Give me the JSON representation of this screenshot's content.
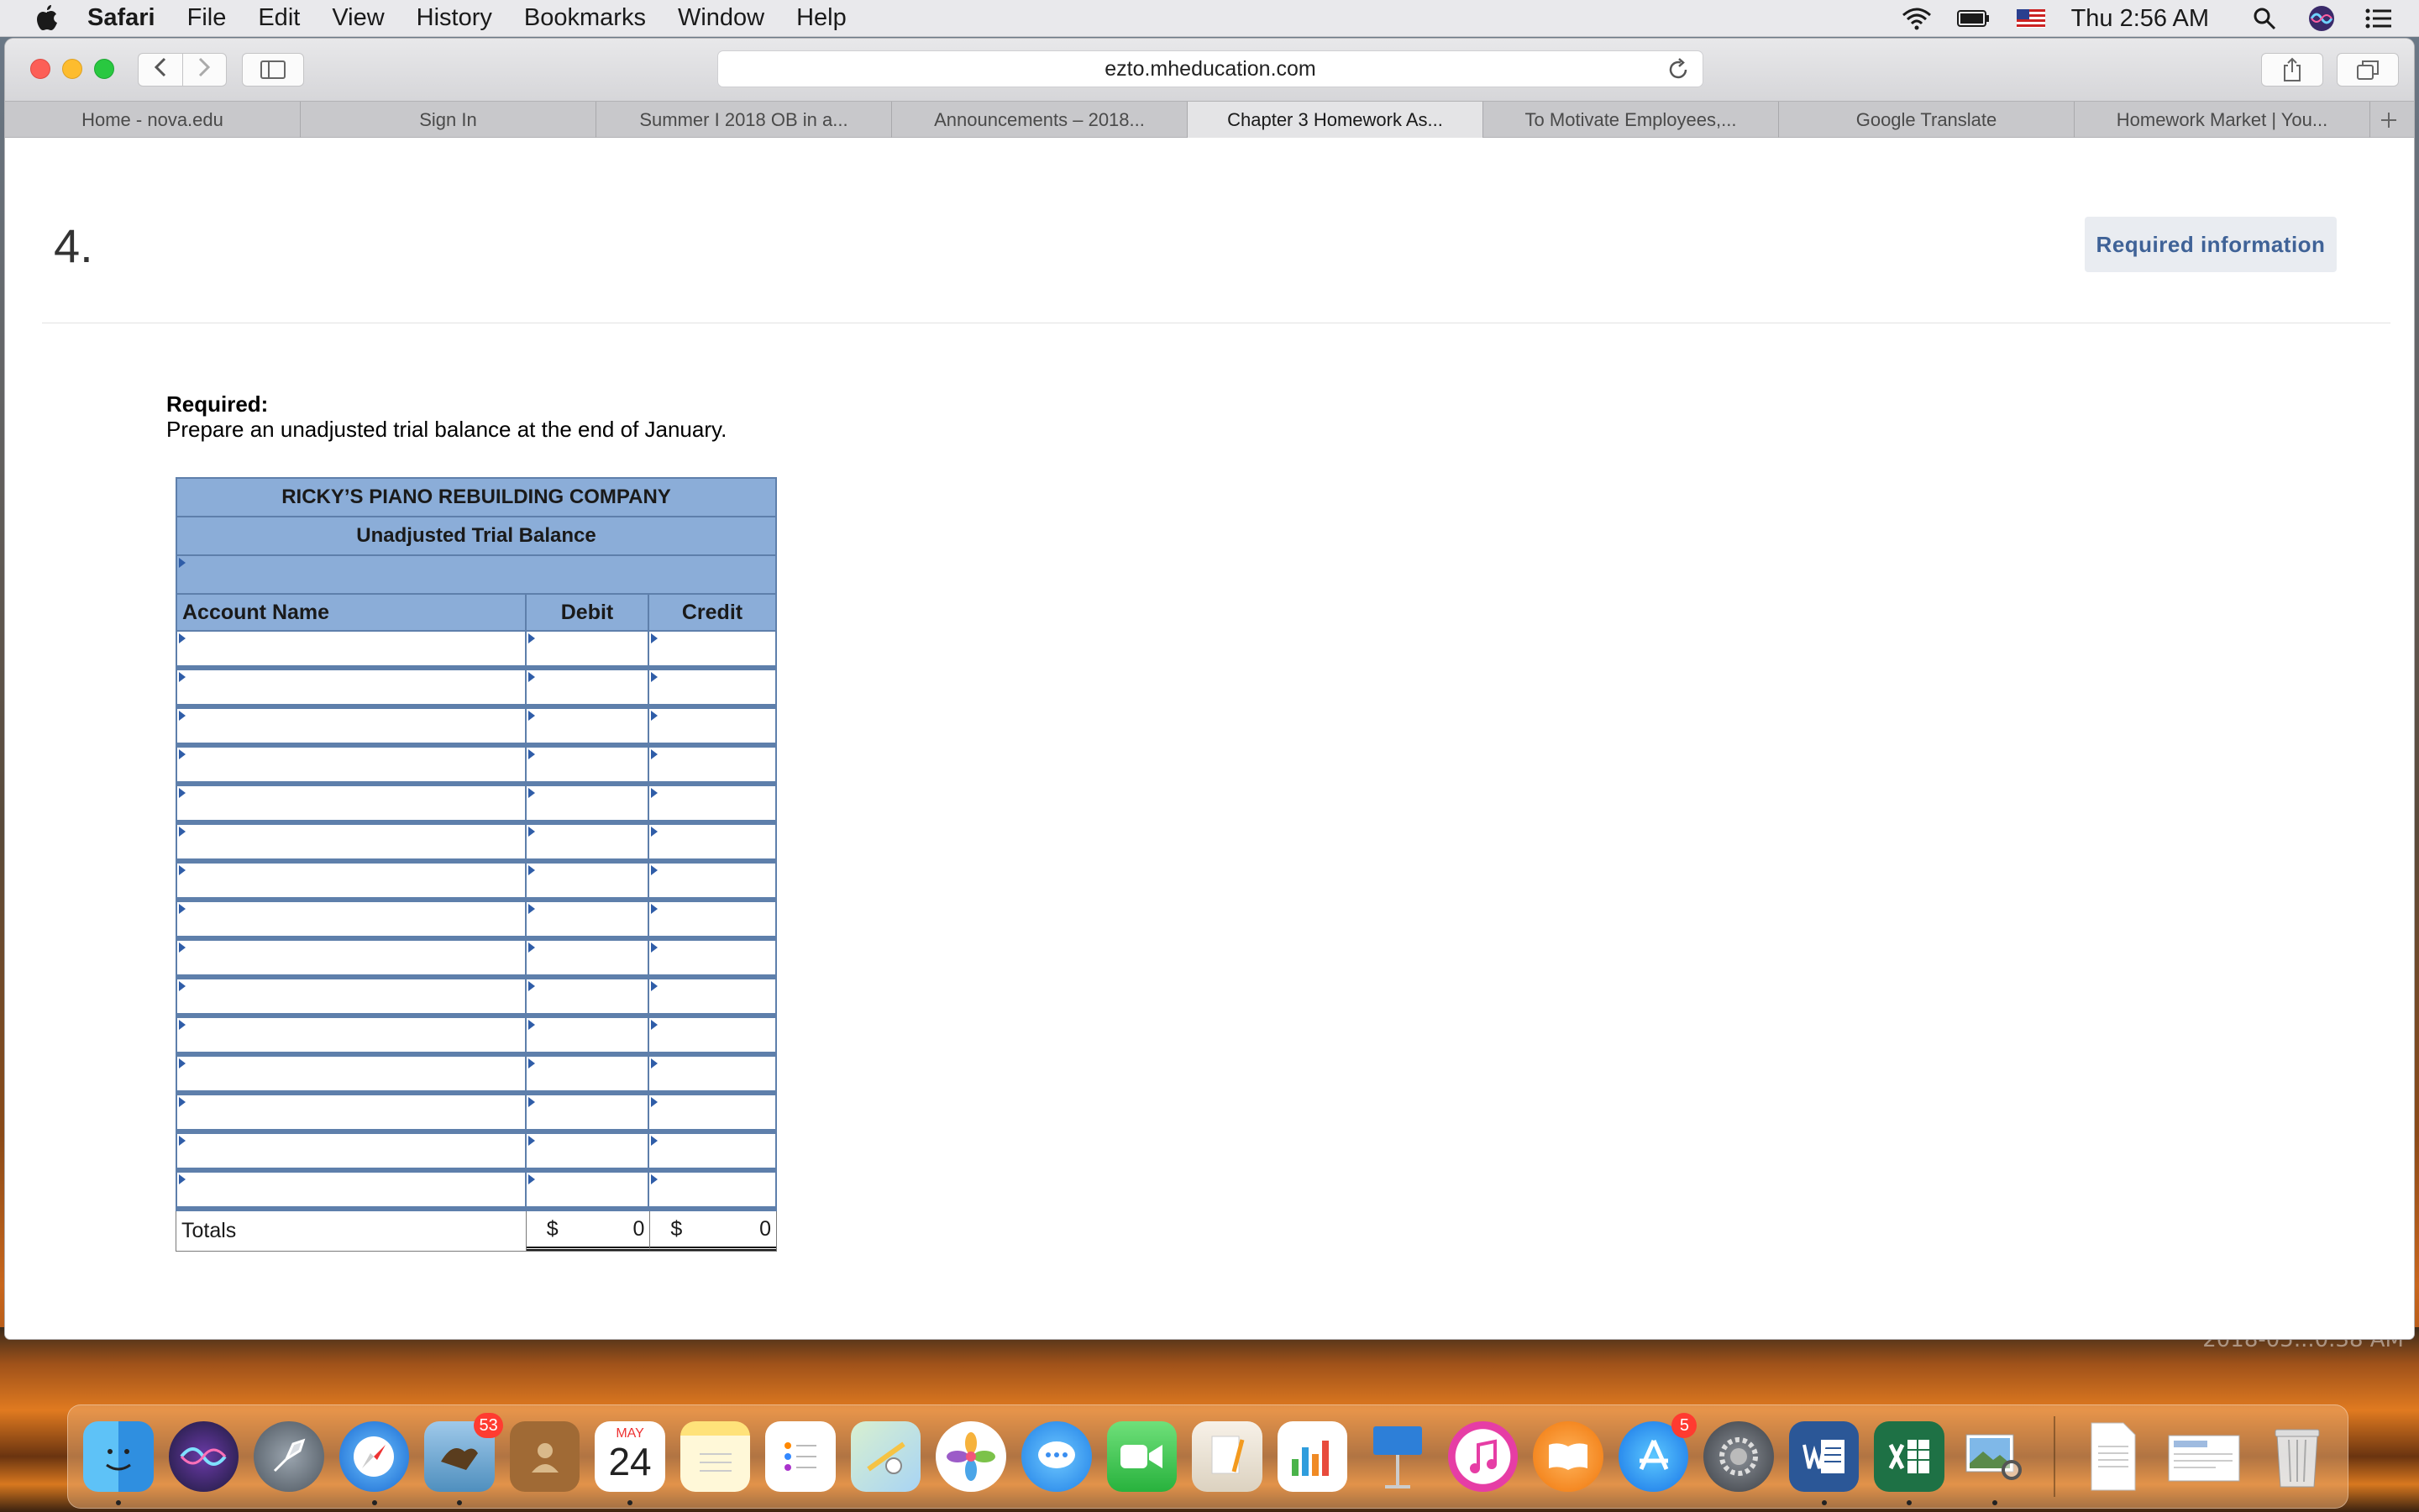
{
  "menubar": {
    "app_name": "Safari",
    "items": [
      "File",
      "Edit",
      "View",
      "History",
      "Bookmarks",
      "Window",
      "Help"
    ],
    "clock": "Thu 2:56 AM",
    "status_icons": [
      "wifi-icon",
      "battery-icon",
      "us-flag-icon",
      "spotlight-search-icon",
      "siri-icon",
      "notification-center-icon"
    ]
  },
  "browser": {
    "url": "ezto.mheducation.com",
    "tabs": [
      {
        "label": "Home - nova.edu",
        "active": false
      },
      {
        "label": "Sign In",
        "active": false
      },
      {
        "label": "Summer I 2018 OB in a...",
        "active": false
      },
      {
        "label": "Announcements – 2018...",
        "active": false
      },
      {
        "label": "Chapter 3 Homework As...",
        "active": true
      },
      {
        "label": "To Motivate Employees,...",
        "active": false
      },
      {
        "label": "Google Translate",
        "active": false
      },
      {
        "label": "Homework Market | You...",
        "active": false
      }
    ]
  },
  "page": {
    "question_number": "4.",
    "required_info_button": "Required information",
    "required_label": "Required:",
    "required_text": "Prepare an unadjusted trial balance at the end of January."
  },
  "trial_balance": {
    "company": "RICKY’S PIANO REBUILDING COMPANY",
    "title": "Unadjusted Trial Balance",
    "columns": {
      "account": "Account Name",
      "debit": "Debit",
      "credit": "Credit"
    },
    "row_count": 15,
    "totals_label": "Totals",
    "currency": "$",
    "debit_total": "0",
    "credit_total": "0"
  },
  "desktop": {
    "watermark": "2018-05...0.38 AM"
  },
  "dock": {
    "badges": {
      "mail": "53",
      "app_store": "5"
    },
    "calendar_month": "MAY",
    "calendar_day": "24"
  },
  "colors": {
    "table_header": "#8badd8",
    "table_border": "#5e7fab",
    "required_info_text": "#3f6297"
  }
}
